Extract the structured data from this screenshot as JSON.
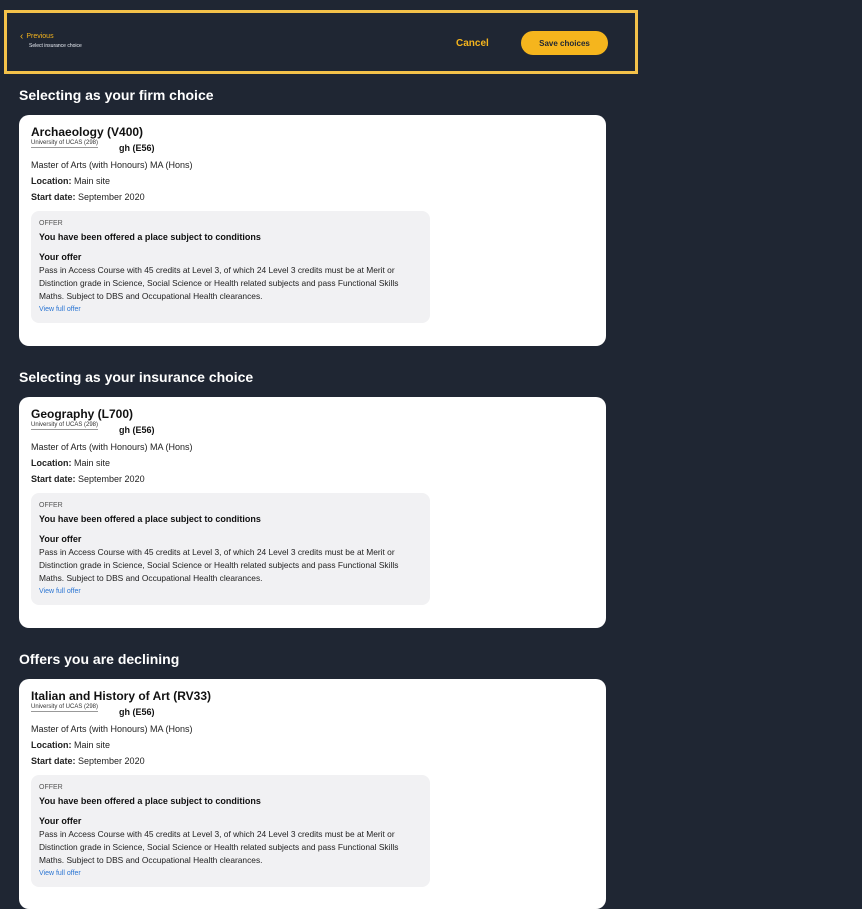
{
  "header": {
    "previous_label": "Previous",
    "subtitle": "Select insurance choice",
    "cancel_label": "Cancel",
    "save_label": "Save choices",
    "accent_color": "#f5b51d"
  },
  "sections": [
    {
      "title": "Selecting as your firm choice",
      "card": {
        "course": "Archaeology (V400)",
        "university_name": "University of UCAS (298)",
        "university_code_suffix": "gh (E56)",
        "qualification": "Master of Arts (with Honours) MA (Hons)",
        "location_label": "Location:",
        "location_value": "Main site",
        "start_label": "Start date:",
        "start_value": "September 2020",
        "offer": {
          "tag": "OFFER",
          "status": "You have been offered a place subject to conditions",
          "heading": "Your offer",
          "text": "Pass in Access Course with 45 credits at Level 3, of which 24 Level 3 credits must be at Merit or Distinction grade in Science, Social Science or Health related subjects and pass Functional Skills Maths. Subject to DBS and Occupational Health clearances.",
          "link": "View full offer"
        }
      }
    },
    {
      "title": "Selecting as your insurance choice",
      "card": {
        "course": "Geography (L700)",
        "university_name": "University of UCAS (298)",
        "university_code_suffix": "gh (E56)",
        "qualification": "Master of Arts (with Honours) MA (Hons)",
        "location_label": "Location:",
        "location_value": "Main site",
        "start_label": "Start date:",
        "start_value": "September 2020",
        "offer": {
          "tag": "OFFER",
          "status": "You have been offered a place subject to conditions",
          "heading": "Your offer",
          "text": "Pass in Access Course with 45 credits at Level 3, of which 24 Level 3 credits must be at Merit or Distinction grade in Science, Social Science or Health related subjects and pass Functional Skills Maths. Subject to DBS and Occupational Health clearances.",
          "link": "View full offer"
        }
      }
    },
    {
      "title": "Offers you are declining",
      "card": {
        "course": "Italian and History of Art (RV33)",
        "university_name": "University of UCAS (298)",
        "university_code_suffix": "gh (E56)",
        "qualification": "Master of Arts (with Honours) MA (Hons)",
        "location_label": "Location:",
        "location_value": "Main site",
        "start_label": "Start date:",
        "start_value": "September 2020",
        "offer": {
          "tag": "OFFER",
          "status": "You have been offered a place subject to conditions",
          "heading": "Your offer",
          "text": "Pass in Access Course with 45 credits at Level 3, of which 24 Level 3 credits must be at Merit or Distinction grade in Science, Social Science or Health related subjects and pass Functional Skills Maths. Subject to DBS and Occupational Health clearances.",
          "link": "View full offer"
        }
      }
    }
  ]
}
